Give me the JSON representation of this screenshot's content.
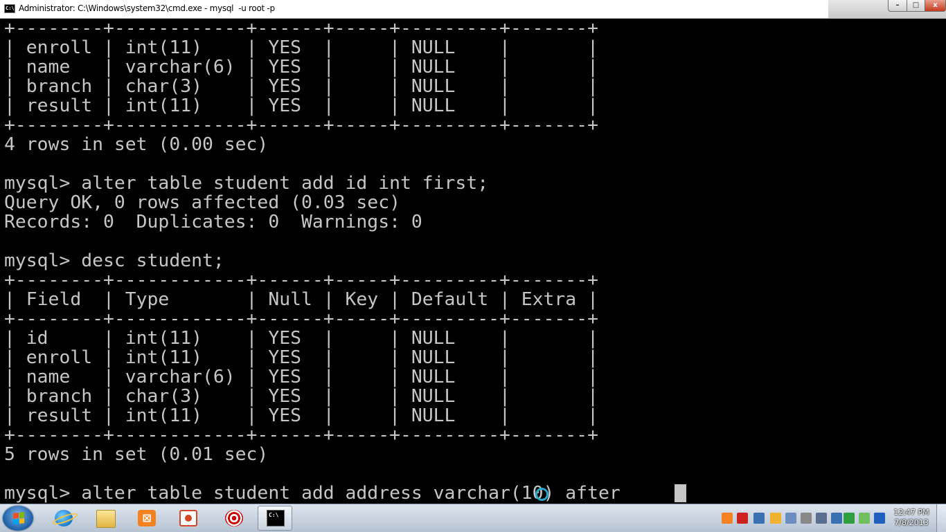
{
  "window": {
    "title": "Administrator: C:\\Windows\\system32\\cmd.exe - mysql  -u root -p",
    "icon_label": "C:\\",
    "min_label": "–",
    "max_label": "□",
    "close_label": "x"
  },
  "console": {
    "lines": [
      "+--------+------------+------+-----+---------+-------+",
      "| enroll | int(11)    | YES  |     | NULL    |       |",
      "| name   | varchar(6) | YES  |     | NULL    |       |",
      "| branch | char(3)    | YES  |     | NULL    |       |",
      "| result | int(11)    | YES  |     | NULL    |       |",
      "+--------+------------+------+-----+---------+-------+",
      "4 rows in set (0.00 sec)",
      "",
      "mysql> alter table student add id int first;",
      "Query OK, 0 rows affected (0.03 sec)",
      "Records: 0  Duplicates: 0  Warnings: 0",
      "",
      "mysql> desc student;",
      "+--------+------------+------+-----+---------+-------+",
      "| Field  | Type       | Null | Key | Default | Extra |",
      "+--------+------------+------+-----+---------+-------+",
      "| id     | int(11)    | YES  |     | NULL    |       |",
      "| enroll | int(11)    | YES  |     | NULL    |       |",
      "| name   | varchar(6) | YES  |     | NULL    |       |",
      "| branch | char(3)    | YES  |     | NULL    |       |",
      "| result | int(11)    | YES  |     | NULL    |       |",
      "+--------+------------+------+-----+---------+-------+",
      "5 rows in set (0.01 sec)",
      "",
      "mysql> alter table student add address varchar(10) after "
    ]
  },
  "taskbar": {
    "apps": [
      {
        "name": "internet-explorer",
        "active": false
      },
      {
        "name": "windows-explorer",
        "active": false
      },
      {
        "name": "xampp",
        "active": false,
        "glyph": "⊠"
      },
      {
        "name": "powerpoint",
        "active": false
      },
      {
        "name": "target-app",
        "active": false
      },
      {
        "name": "command-prompt",
        "active": true,
        "glyph": "C:\\"
      }
    ],
    "clock": {
      "time": "12:47 PM",
      "date": "7/8/2013"
    },
    "tray_colors": [
      "#f58220",
      "#cc2222",
      "#3a6fb0",
      "#f0b030",
      "#6a8fbf",
      "#888888",
      "#5a6f8f",
      "#3a6fb0",
      "#2e9e3e",
      "#6fbf5f",
      "#1f5fbf"
    ]
  }
}
